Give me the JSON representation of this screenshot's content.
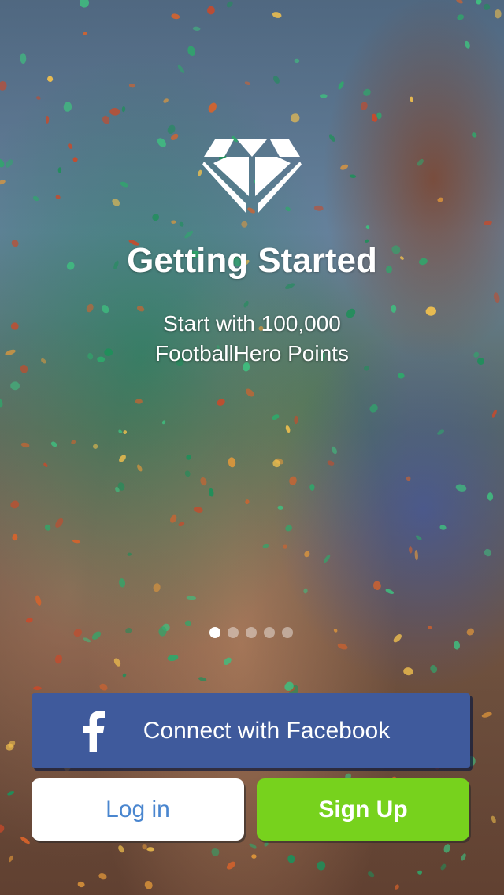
{
  "onboarding": {
    "title": "Getting Started",
    "subtitle_lines": [
      "Start with 100,000",
      "FootballHero Points"
    ],
    "pager": {
      "total_pages": 5,
      "current_page": 1
    }
  },
  "actions": {
    "facebook_label": "Connect with Facebook",
    "login_label": "Log in",
    "signup_label": "Sign Up"
  },
  "colors": {
    "facebook_blue": "#3f5a9c",
    "login_text": "#4a86cf",
    "signup_green": "#77d21d"
  },
  "icons": {
    "logo": "diamond-icon",
    "facebook": "facebook-f-icon"
  }
}
